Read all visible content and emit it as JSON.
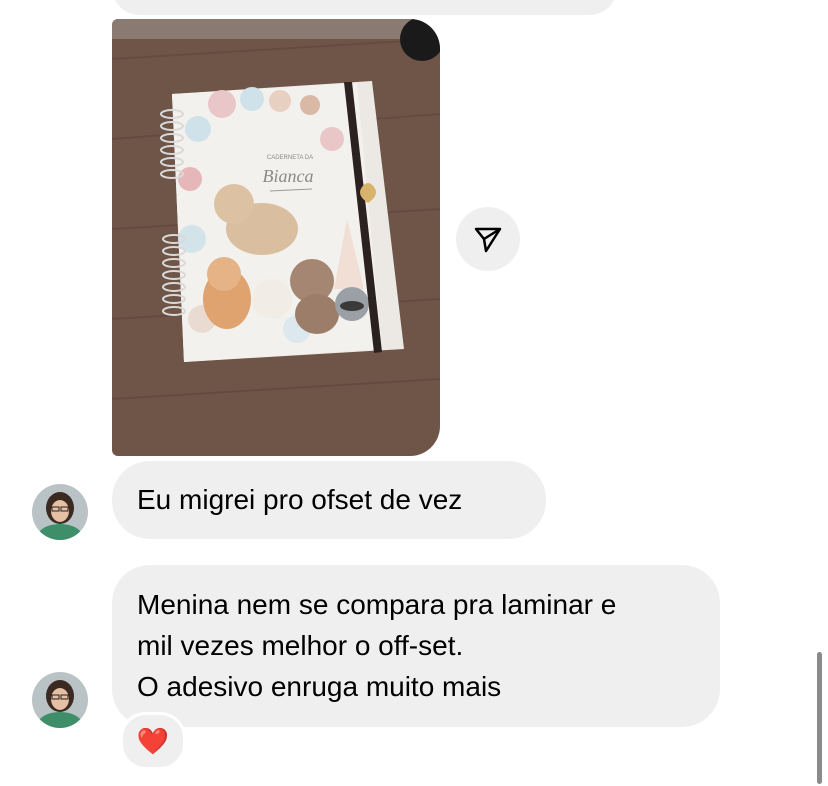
{
  "messages": [
    {
      "type": "image",
      "alt": ""
    },
    {
      "type": "text",
      "text": "Eu migrei pro ofset  de vez"
    },
    {
      "type": "text",
      "lines": [
        "Menina nem se compara pra laminar e",
        "mil vezes  melhor o off-set.",
        "O adesivo enruga muito mais"
      ]
    }
  ],
  "reaction": {
    "emoji": "❤️"
  },
  "photo": {
    "notebook_label_top": "CADERNETA DA",
    "notebook_label_name": "Bianca"
  },
  "colors": {
    "bubble": "#efefef",
    "reaction_heart": "#e0132f"
  },
  "icons": {
    "share": "send-icon",
    "heart": "heart-icon"
  }
}
